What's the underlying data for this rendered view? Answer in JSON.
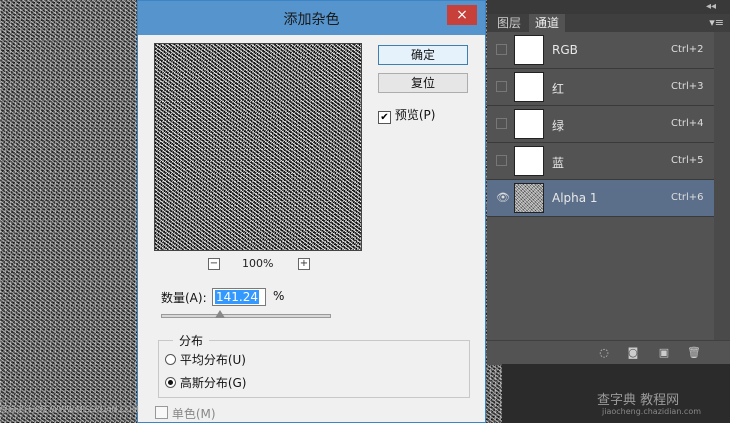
{
  "dialog": {
    "title": "添加杂色",
    "close": "×",
    "ok_label": "确定",
    "reset_label": "复位",
    "preview_label": "预览(P)",
    "preview_checked": "✔",
    "zoom_minus": "−",
    "zoom_plus": "+",
    "zoom": "100%",
    "amount_label": "数量(A):",
    "amount_value": "141.24",
    "amount_unit": "%",
    "distribution_title": "分布",
    "uniform_label": "平均分布(U)",
    "gaussian_label": "高斯分布(G)",
    "mono_label": "单色(M)"
  },
  "panel": {
    "collapse": "◂◂",
    "menu": "▾≡",
    "tab_layers": "图层",
    "tab_channels": "通道",
    "channels": [
      {
        "name": "RGB",
        "shortcut": "Ctrl+2"
      },
      {
        "name": "红",
        "shortcut": "Ctrl+3"
      },
      {
        "name": "绿",
        "shortcut": "Ctrl+4"
      },
      {
        "name": "蓝",
        "shortcut": "Ctrl+5"
      },
      {
        "name": "Alpha 1",
        "shortcut": "Ctrl+6"
      }
    ],
    "eye": "👁"
  },
  "icons": [
    "dotted-circle-icon",
    "mask-icon",
    "new-channel-icon",
    "trash-icon"
  ],
  "watermark": {
    "line1": "查字典 教程网",
    "line2": "jiaocheng.chazidian.com",
    "left": "思缘设计论坛 WWW.MISSYUAN.COM"
  }
}
